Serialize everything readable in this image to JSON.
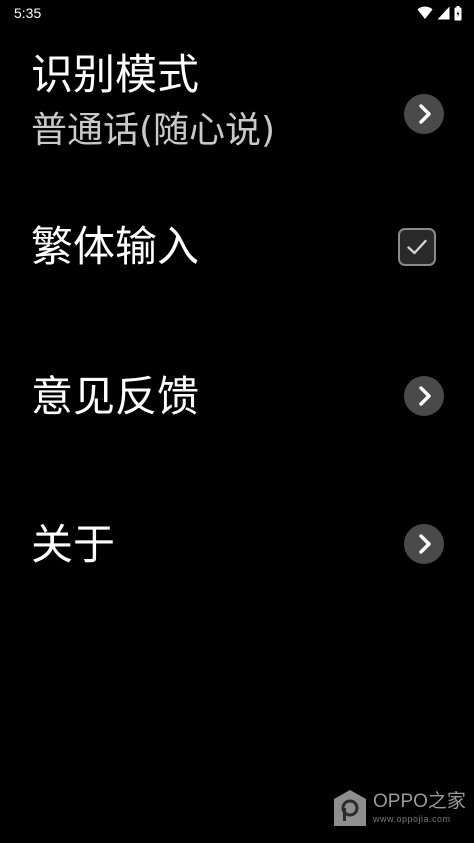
{
  "status_bar": {
    "time": "5:35"
  },
  "settings": {
    "recognition_mode": {
      "title": "识别模式",
      "value": "普通话(随心说)"
    },
    "traditional_input": {
      "title": "繁体输入",
      "checked": true
    },
    "feedback": {
      "title": "意见反馈"
    },
    "about": {
      "title": "关于"
    }
  },
  "watermark": {
    "brand": "OPPO之家",
    "url": "www.oppojia.com"
  },
  "colors": {
    "background": "#000000",
    "text_primary": "#ffffff",
    "text_secondary": "#c9c9c9",
    "chevron_button": "#4a4a4a"
  },
  "icons": {
    "wifi": "wifi-icon",
    "signal": "cellular-signal-icon",
    "battery": "battery-icon",
    "chevron": "chevron-right-icon",
    "check": "check-icon"
  }
}
